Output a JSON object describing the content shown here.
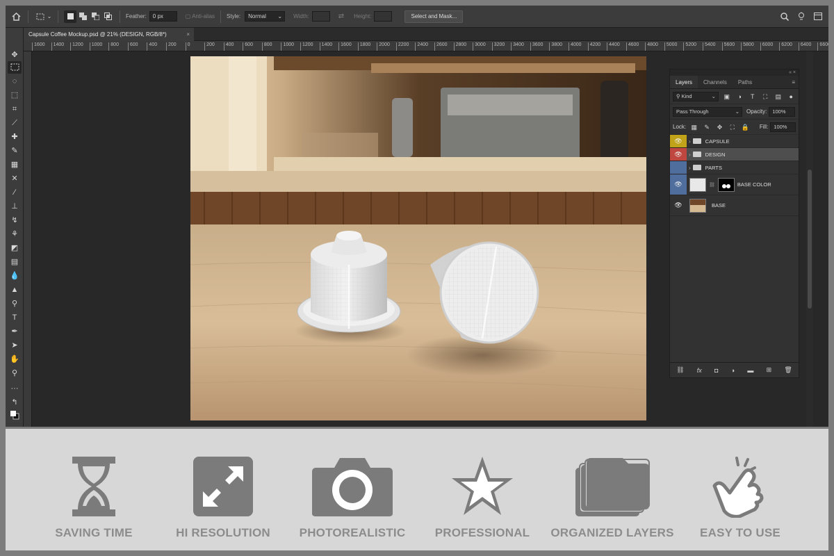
{
  "options_bar": {
    "feather_label": "Feather:",
    "feather_value": "0 px",
    "antialias_label": "Anti-alias",
    "style_label": "Style:",
    "style_value": "Normal",
    "width_label": "Width:",
    "height_label": "Height:",
    "select_mask_label": "Select and Mask..."
  },
  "document": {
    "tab_title": "Capsule Coffee Mockup.psd @ 21% (DESIGN, RGB/8*)",
    "close_label": "×"
  },
  "ruler": {
    "ticks": [
      "1600",
      "1400",
      "1200",
      "1000",
      "800",
      "600",
      "400",
      "200",
      "0",
      "200",
      "400",
      "600",
      "800",
      "1000",
      "1200",
      "1400",
      "1600",
      "1800",
      "2000",
      "2200",
      "2400",
      "2600",
      "2800",
      "3000",
      "3200",
      "3400",
      "3600",
      "3800",
      "4000",
      "4200",
      "4400",
      "4600",
      "4800",
      "5000",
      "5200",
      "5400",
      "5600",
      "5800",
      "6000",
      "6200",
      "6400",
      "6600"
    ]
  },
  "layers_panel": {
    "collapse_label": "«  ×",
    "tabs": [
      "Layers",
      "Channels",
      "Paths"
    ],
    "menu_label": "≡",
    "kind_label": "Kind",
    "blend_mode": "Pass Through",
    "opacity_label": "Opacity:",
    "opacity_value": "100%",
    "lock_label": "Lock:",
    "fill_label": "Fill:",
    "fill_value": "100%",
    "layers": [
      {
        "name": "CAPSULE",
        "color": "#c0a318",
        "type": "group"
      },
      {
        "name": "DESIGN",
        "color": "#c0473f",
        "type": "group"
      },
      {
        "name": "PARTS",
        "color": "#4f6e9e",
        "type": "group"
      },
      {
        "name": "BASE COLOR",
        "color": "#4f6e9e",
        "type": "layer-mask"
      },
      {
        "name": "BASE",
        "color": "",
        "type": "image"
      }
    ]
  },
  "features": [
    {
      "label": "SAVING TIME",
      "icon": "hourglass-icon"
    },
    {
      "label": "HI RESOLUTION",
      "icon": "expand-icon"
    },
    {
      "label": "PHOTOREALISTIC",
      "icon": "camera-icon"
    },
    {
      "label": "PROFESSIONAL",
      "icon": "star-icon"
    },
    {
      "label": "ORGANIZED LAYERS",
      "icon": "layers-icon"
    },
    {
      "label": "EASY TO USE",
      "icon": "pointer-hand-icon"
    }
  ],
  "colors": {
    "feature_icon": "#7b7b7b",
    "feature_bg": "#d7d7d7",
    "app_bg": "#282828"
  }
}
